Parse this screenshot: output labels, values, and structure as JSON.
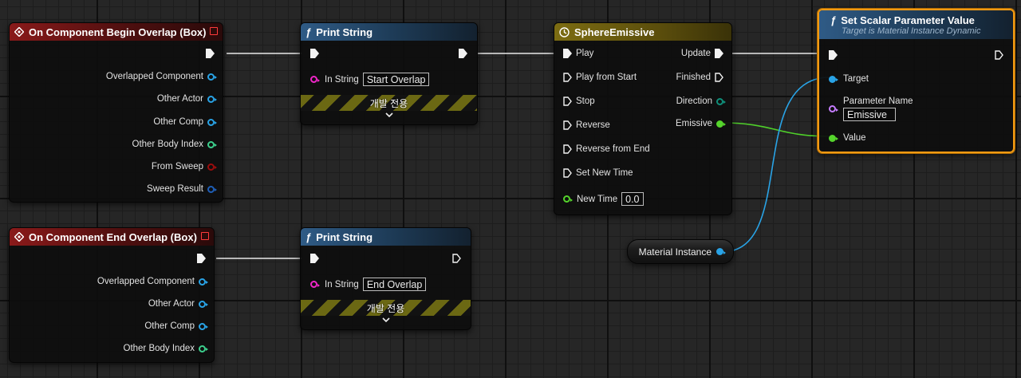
{
  "begin_overlap": {
    "title": "On Component Begin Overlap (Box)",
    "outputs": [
      "Overlapped Component",
      "Other Actor",
      "Other Comp",
      "Other Body Index",
      "From Sweep",
      "Sweep Result"
    ]
  },
  "end_overlap": {
    "title": "On Component End Overlap (Box)",
    "outputs": [
      "Overlapped Component",
      "Other Actor",
      "Other Comp",
      "Other Body Index"
    ]
  },
  "print_begin": {
    "title": "Print String",
    "in_label": "In String",
    "in_value": "Start Overlap",
    "dev_label": "개발 전용"
  },
  "print_end": {
    "title": "Print String",
    "in_label": "In String",
    "in_value": "End Overlap",
    "dev_label": "개발 전용"
  },
  "timeline": {
    "title": "SphereEmissive",
    "inputs": [
      "Play",
      "Play from Start",
      "Stop",
      "Reverse",
      "Reverse from End",
      "Set New Time"
    ],
    "new_time_label": "New Time",
    "new_time_value": "0.0",
    "outputs": [
      "Update",
      "Finished",
      "Direction",
      "Emissive"
    ]
  },
  "set_scalar": {
    "title": "Set Scalar Parameter Value",
    "subtitle": "Target is Material Instance Dynamic",
    "target_label": "Target",
    "param_label": "Parameter Name",
    "param_value": "Emissive",
    "value_label": "Value"
  },
  "material_var": {
    "label": "Material Instance"
  },
  "colors": {
    "exec": "#f2f2f2",
    "object_pin": "#29a3e6",
    "int_pin": "#3ccf8c",
    "struct_pin": "#1f5fb8",
    "bool_pin": "#9b0d0d",
    "string_pin": "#f026c8",
    "name_pin": "#c67dff",
    "float_pin": "#55d42c",
    "enum_pin": "#0f8f7a",
    "selected_outline": "#f29a13"
  }
}
